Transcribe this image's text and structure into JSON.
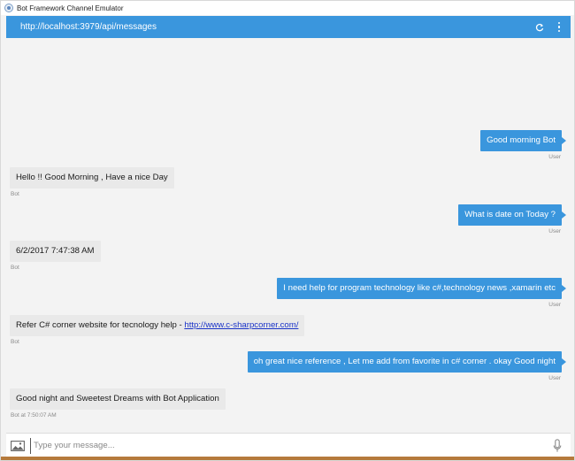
{
  "window": {
    "title": "Bot Framework Channel Emulator"
  },
  "addressbar": {
    "url": "http://localhost:3979/api/messages"
  },
  "messages": [
    {
      "from": "user",
      "text": "Good morning Bot",
      "meta": "User"
    },
    {
      "from": "bot",
      "text": "Hello !! Good Morning , Have a nice Day",
      "meta": "Bot"
    },
    {
      "from": "user",
      "text": "What is date on Today ?",
      "meta": "User"
    },
    {
      "from": "bot",
      "text": "6/2/2017 7:47:38 AM",
      "meta": "Bot"
    },
    {
      "from": "user",
      "text": "I need help for program technology like c#,technology news ,xamarin etc",
      "meta": "User"
    },
    {
      "from": "bot",
      "text": "Refer C# corner website for tecnology help - ",
      "link": "http://www.c-sharpcorner.com/",
      "meta": "Bot"
    },
    {
      "from": "user",
      "text": "oh great nice reference , Let me add from favorite in c# corner . okay Good night",
      "meta": "User"
    },
    {
      "from": "bot",
      "text": "Good night and Sweetest Dreams with Bot Application",
      "meta": "Bot at 7:50:07 AM"
    }
  ],
  "composer": {
    "placeholder": "Type your message..."
  },
  "colors": {
    "accent": "#3a96dd",
    "bot_bubble": "#e9e9e9",
    "background": "#f3f3f3"
  }
}
